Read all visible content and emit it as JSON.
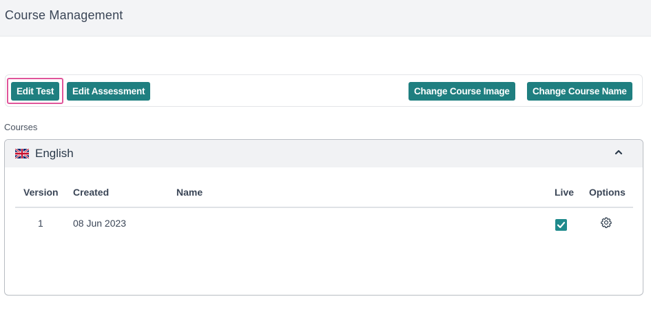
{
  "header": {
    "title": "Course Management"
  },
  "toolbar": {
    "edit_test": "Edit Test",
    "edit_assessment": "Edit Assessment",
    "change_image": "Change Course Image",
    "change_name": "Change Course Name"
  },
  "courses": {
    "label": "Courses",
    "language": "English",
    "flag_icon": "uk-flag-icon",
    "collapse_icon": "chevron-up-icon",
    "columns": [
      "Version",
      "Created",
      "Name",
      "Live",
      "Options"
    ],
    "rows": [
      {
        "version": "1",
        "created": "08 Jun 2023",
        "name": "",
        "live": true,
        "options_icon": "gear-icon"
      }
    ]
  },
  "colors": {
    "accent": "#1f7f80",
    "highlight": "#e0559a",
    "checkbox": "#1f8a8c"
  }
}
